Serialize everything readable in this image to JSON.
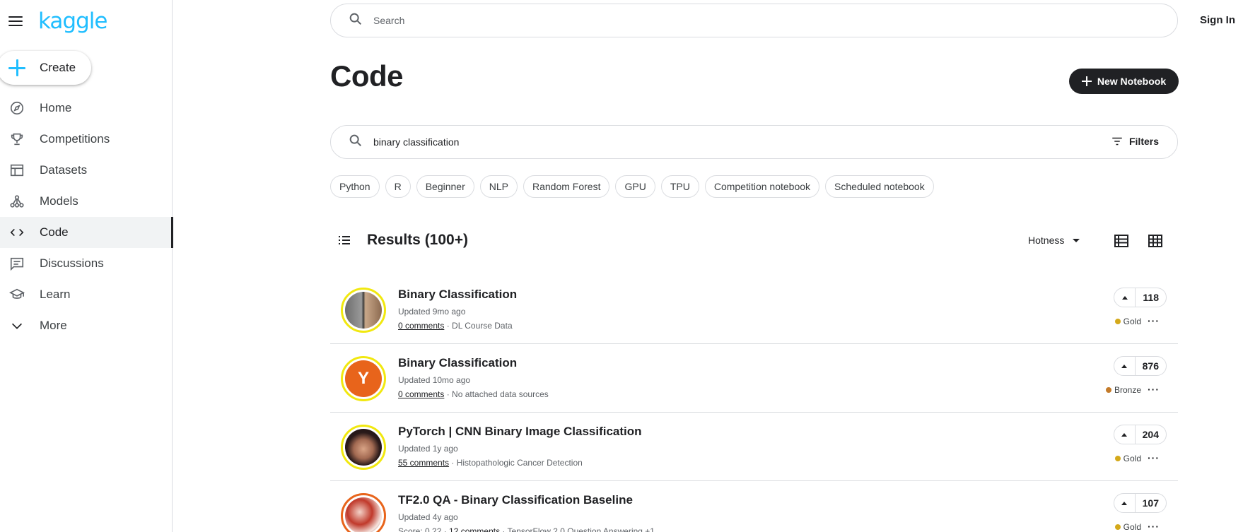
{
  "app": {
    "logo": "kaggle"
  },
  "sidebar": {
    "create_label": "Create",
    "items": [
      {
        "label": "Home",
        "icon": "compass-icon"
      },
      {
        "label": "Competitions",
        "icon": "trophy-icon"
      },
      {
        "label": "Datasets",
        "icon": "table-icon"
      },
      {
        "label": "Models",
        "icon": "models-icon"
      },
      {
        "label": "Code",
        "icon": "code-icon",
        "active": true
      },
      {
        "label": "Discussions",
        "icon": "comment-icon"
      },
      {
        "label": "Learn",
        "icon": "school-icon"
      },
      {
        "label": "More",
        "icon": "chevron-down-icon"
      }
    ]
  },
  "header": {
    "search_placeholder": "Search",
    "sign_in": "Sign In"
  },
  "page": {
    "title": "Code",
    "new_notebook_label": "New Notebook",
    "query": "binary classification",
    "filters_label": "Filters",
    "chips": [
      "Python",
      "R",
      "Beginner",
      "NLP",
      "Random Forest",
      "GPU",
      "TPU",
      "Competition notebook",
      "Scheduled notebook"
    ],
    "results_title": "Results (100+)",
    "sort": "Hotness"
  },
  "results": [
    {
      "title": "Binary Classification",
      "updated": "Updated 9mo ago",
      "meta_prefix": "",
      "comments": "0 comments",
      "source": " · DL Course Data",
      "votes": "118",
      "medal": "Gold",
      "medal_color": "#d4a91a"
    },
    {
      "title": "Binary Classification",
      "updated": "Updated 10mo ago",
      "meta_prefix": "",
      "comments": "0 comments",
      "source": " · No attached data sources",
      "votes": "876",
      "medal": "Bronze",
      "medal_color": "#c47b2a"
    },
    {
      "title": "PyTorch | CNN Binary Image Classification",
      "updated": "Updated 1y ago",
      "meta_prefix": "",
      "comments": "55 comments",
      "source": " · Histopathologic Cancer Detection",
      "votes": "204",
      "medal": "Gold",
      "medal_color": "#d4a91a"
    },
    {
      "title": "TF2.0 QA - Binary Classification Baseline",
      "updated": "Updated 4y ago",
      "meta_prefix": "Score: 0.22 · ",
      "comments": "12 comments",
      "source": " · TensorFlow 2.0 Question Answering +1",
      "votes": "107",
      "medal": "Gold",
      "medal_color": "#d4a91a"
    }
  ],
  "colors": {
    "accent": "#20beff",
    "highlight_ring": "#f1e80f",
    "dark_button": "#202124"
  }
}
